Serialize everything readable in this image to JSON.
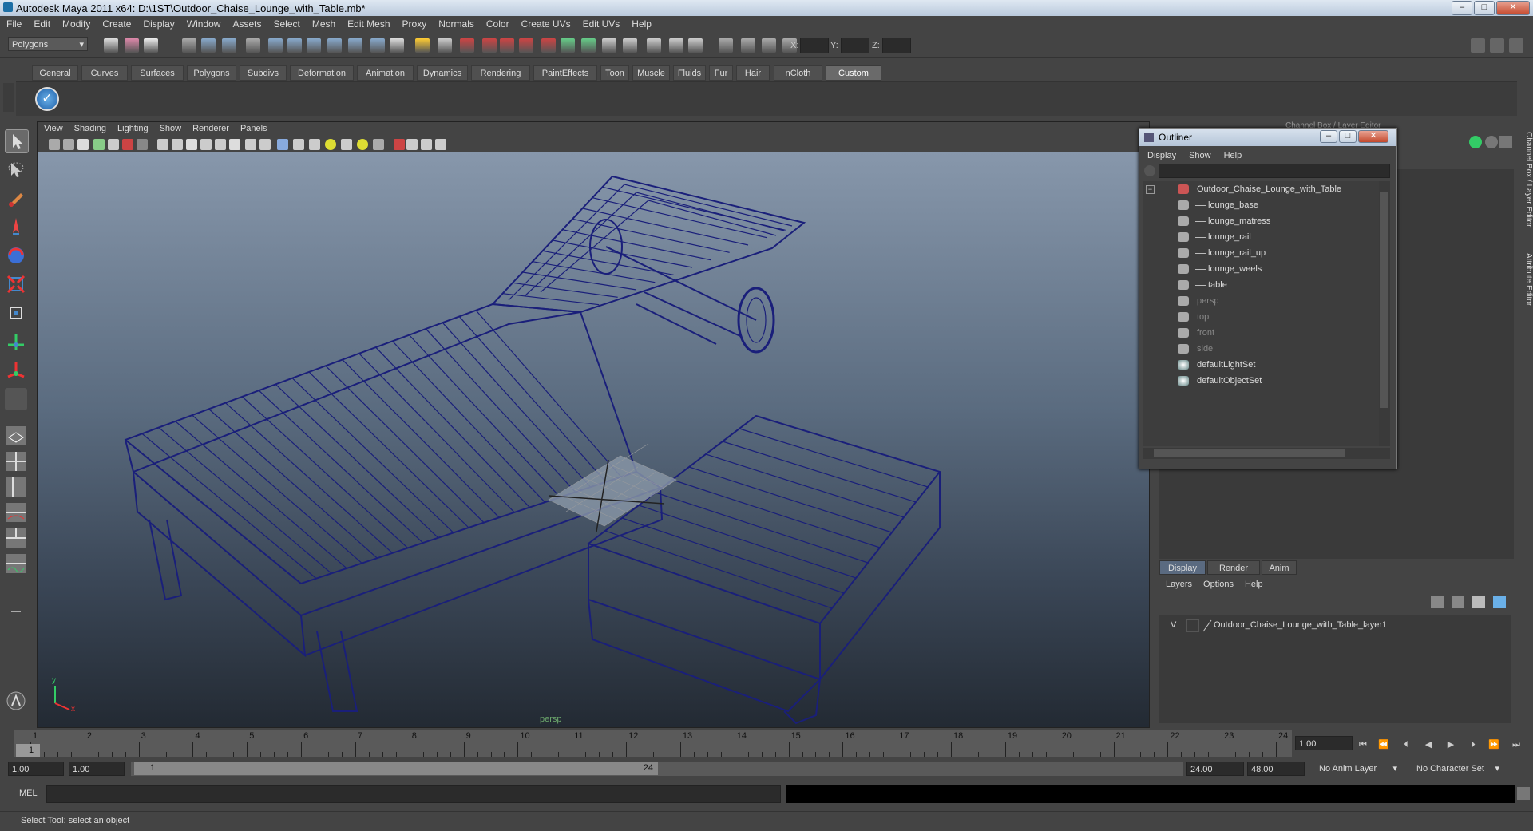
{
  "window": {
    "title": "Autodesk Maya 2011 x64: D:\\1ST\\Outdoor_Chaise_Lounge_with_Table.mb*"
  },
  "menubar": [
    "File",
    "Edit",
    "Modify",
    "Create",
    "Display",
    "Window",
    "Assets",
    "Select",
    "Mesh",
    "Edit Mesh",
    "Proxy",
    "Normals",
    "Color",
    "Create UVs",
    "Edit UVs",
    "Help"
  ],
  "toolbar": {
    "mode": "Polygons",
    "x_label": "X:",
    "y_label": "Y:",
    "z_label": "Z:"
  },
  "shelf_tabs": [
    {
      "label": "General"
    },
    {
      "label": "Curves"
    },
    {
      "label": "Surfaces"
    },
    {
      "label": "Polygons"
    },
    {
      "label": "Subdivs"
    },
    {
      "label": "Deformation"
    },
    {
      "label": "Animation"
    },
    {
      "label": "Dynamics"
    },
    {
      "label": "Rendering"
    },
    {
      "label": "PaintEffects"
    },
    {
      "label": "Toon"
    },
    {
      "label": "Muscle"
    },
    {
      "label": "Fluids"
    },
    {
      "label": "Fur"
    },
    {
      "label": "Hair"
    },
    {
      "label": "nCloth"
    },
    {
      "label": "Custom"
    }
  ],
  "active_shelf_tab": "Custom",
  "viewport": {
    "menu": [
      "View",
      "Shading",
      "Lighting",
      "Show",
      "Renderer",
      "Panels"
    ],
    "camera": "persp",
    "axis_x": "x",
    "axis_y": "y"
  },
  "outliner": {
    "title": "Outliner",
    "menu": [
      "Display",
      "Show",
      "Help"
    ],
    "root": "Outdoor_Chaise_Lounge_with_Table",
    "children": [
      "lounge_base",
      "lounge_matress",
      "lounge_rail",
      "lounge_rail_up",
      "lounge_weels",
      "table"
    ],
    "cameras": [
      "persp",
      "top",
      "front",
      "side"
    ],
    "sets": [
      "defaultLightSet",
      "defaultObjectSet"
    ]
  },
  "channel_box": {
    "title": "Channel Box / Layer Editor",
    "side_tabs": [
      "Channel Box / Layer Editor",
      "Attribute Editor"
    ]
  },
  "layer_editor": {
    "tabs": [
      "Display",
      "Render",
      "Anim"
    ],
    "active_tab": "Display",
    "menu": [
      "Layers",
      "Options",
      "Help"
    ],
    "layer": {
      "visible": "V",
      "name": "Outdoor_Chaise_Lounge_with_Table_layer1"
    }
  },
  "timeline": {
    "start": 1,
    "end": 24,
    "current_frame_display": "1",
    "current_time": "1.00"
  },
  "range": {
    "start_time": "1.00",
    "playback_start": "1.00",
    "slider_start": "1",
    "slider_end": "24",
    "playback_end": "24.00",
    "end_time": "48.00",
    "anim_layer": "No Anim Layer",
    "character_set": "No Character Set"
  },
  "command_line": {
    "label": "MEL"
  },
  "status": "Select Tool: select an object",
  "colors": {
    "wireframe": "#1a1f7a",
    "panel_bg": "#444444",
    "scene_top": "#8797ab",
    "scene_bottom": "#232a33"
  }
}
